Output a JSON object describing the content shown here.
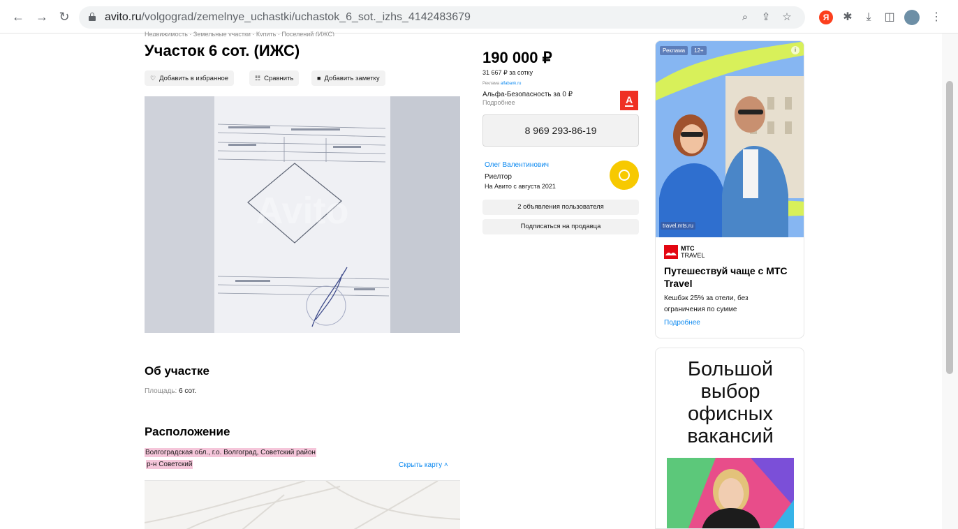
{
  "browser": {
    "url_domain": "avito.ru",
    "url_path": "/volgograd/zemelnye_uchastki/uchastok_6_sot._izhs_4142483679"
  },
  "listing": {
    "breadcrumbs": "Недвижимость · Земельные участки · Купить · Поселений (ИЖС)",
    "title": "Участок 6 сот. (ИЖС)",
    "favorite_label": "Добавить в избранное",
    "compare_label": "Сравнить",
    "note_label": "Добавить заметку",
    "photo_watermark": "Avito",
    "about_heading": "Об участке",
    "area_label": "Площадь:",
    "area_value": "6 сот.",
    "location_heading": "Расположение",
    "address_line1": "Волгоградская обл., г.о. Волгоград, Советский район",
    "address_line2": "р-н Советский",
    "hide_map_label": "Скрыть карту"
  },
  "price_block": {
    "price": "190 000 ₽",
    "price_per_unit": "31 667 ₽ за сотку",
    "ad_label": "Реклама",
    "ad_domain": "alfabank.ru",
    "ad_title": "Альфа-Безопасность за 0 ₽",
    "ad_more": "Подробнее",
    "alfa_letter": "А",
    "phone": "8 969 293-86-19"
  },
  "seller": {
    "name": "Олег Валентинович",
    "role": "Риелтор",
    "since": "На Авито с августа 2021",
    "listings_button": "2 объявления пользователя",
    "subscribe_button": "Подписаться на продавца"
  },
  "side_ad_1": {
    "badge_ad": "Реклама",
    "badge_age": "12+",
    "info": "i",
    "image_domain": "travel.mts.ru",
    "brand_line1": "МТС",
    "brand_line2": "TRAVEL",
    "title": "Путешествуй чаще с МТС Travel",
    "description": "Кешбэк 25% за отели, без ограничения по сумме",
    "more": "Подробнее"
  },
  "side_ad_2": {
    "title": "Большой\nвыбор\nофисных\nвакансий"
  },
  "colors": {
    "accent_link": "#0a88f0",
    "highlight": "#f5c6da",
    "alfa_red": "#ef3124",
    "mts_red": "#e30611",
    "avatar_yellow": "#f7c900"
  }
}
